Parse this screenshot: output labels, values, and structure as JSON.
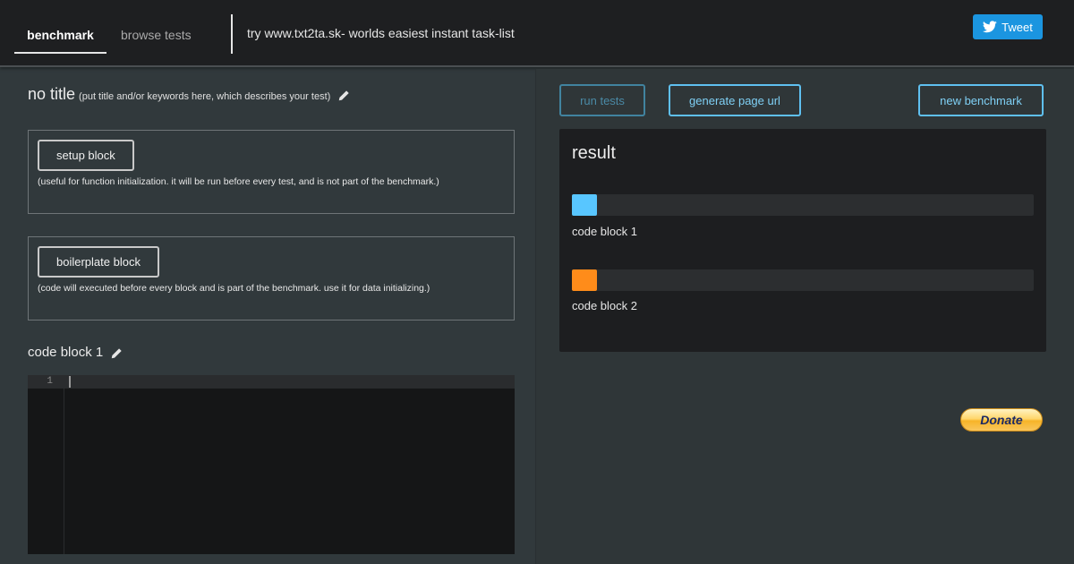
{
  "nav": {
    "tabs": [
      {
        "label": "benchmark",
        "active": true
      },
      {
        "label": "browse tests",
        "active": false
      }
    ],
    "promo": "try www.txt2ta.sk- worlds easiest instant task-list",
    "tweet_label": "Tweet"
  },
  "test": {
    "title": "no title",
    "title_hint": "(put title and/or keywords here, which describes your test)"
  },
  "setup_block": {
    "button_label": "setup block",
    "description": "(useful for function initialization. it will be run before every test, and is not part of the benchmark.)"
  },
  "boilerplate_block": {
    "button_label": "boilerplate block",
    "description": "(code will executed before every block and is part of the benchmark. use it for data initializing.)"
  },
  "code_block": {
    "title": "code block 1",
    "line_numbers": [
      "1"
    ]
  },
  "actions": {
    "run_tests": "run tests",
    "generate_url": "generate page url",
    "new_benchmark": "new benchmark"
  },
  "result": {
    "title": "result",
    "bars": [
      {
        "label": "code block 1",
        "color": "#58c6ff",
        "fill": 0.054
      },
      {
        "label": "code block 2",
        "color": "#ff8c1a",
        "fill": 0.054
      }
    ]
  },
  "donate_label": "Donate",
  "colors": {
    "accent": "#5fc0f0",
    "tweet": "#1b95e0",
    "header_bg": "#1e1f21",
    "body_bg": "#31393c"
  },
  "icons": {
    "edit": "pencil-icon",
    "twitter": "twitter-bird-icon"
  }
}
